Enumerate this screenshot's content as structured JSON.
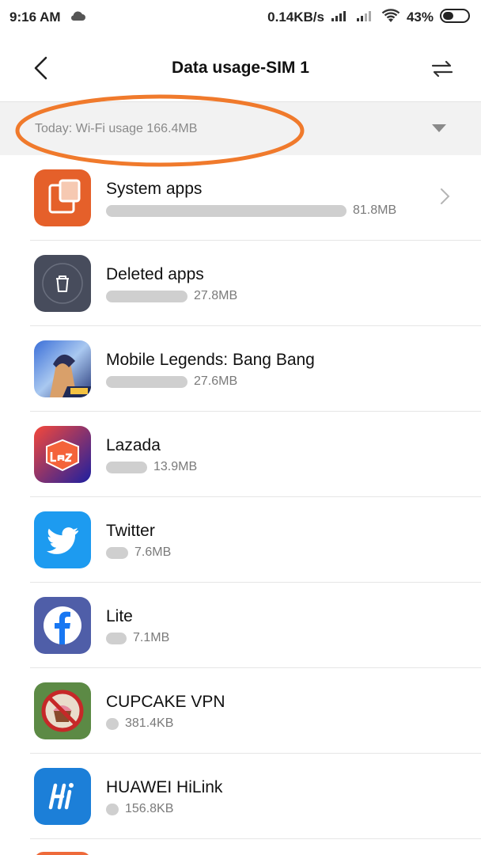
{
  "status": {
    "time": "9:16 AM",
    "speed": "0.14KB/s",
    "battery": "43%"
  },
  "header": {
    "title": "Data usage-SIM 1"
  },
  "filter": {
    "label": "Today: Wi-Fi usage 166.4MB"
  },
  "apps": [
    {
      "name": "System apps",
      "usage": "81.8MB",
      "fraction": 1.0,
      "icon": "system-apps-icon",
      "chevron": true
    },
    {
      "name": "Deleted apps",
      "usage": "27.8MB",
      "fraction": 0.34,
      "icon": "trash-icon",
      "chevron": false
    },
    {
      "name": "Mobile Legends: Bang Bang",
      "usage": "27.6MB",
      "fraction": 0.338,
      "icon": "mobile-legends-icon",
      "chevron": false
    },
    {
      "name": "Lazada",
      "usage": "13.9MB",
      "fraction": 0.17,
      "icon": "lazada-icon",
      "chevron": false
    },
    {
      "name": "Twitter",
      "usage": "7.6MB",
      "fraction": 0.093,
      "icon": "twitter-bird-icon",
      "chevron": false
    },
    {
      "name": "Lite",
      "usage": "7.1MB",
      "fraction": 0.087,
      "icon": "facebook-lite-icon",
      "chevron": false
    },
    {
      "name": "CUPCAKE VPN",
      "usage": "381.4KB",
      "fraction": 0.005,
      "icon": "cupcake-vpn-icon",
      "chevron": false
    },
    {
      "name": "HUAWEI HiLink",
      "usage": "156.8KB",
      "fraction": 0.002,
      "icon": "huawei-hilink-icon",
      "chevron": false
    }
  ],
  "colors": {
    "accent_ellipse": "#f07a2c",
    "bar": "#cfcfcf",
    "filter_bg": "#f2f2f2"
  }
}
